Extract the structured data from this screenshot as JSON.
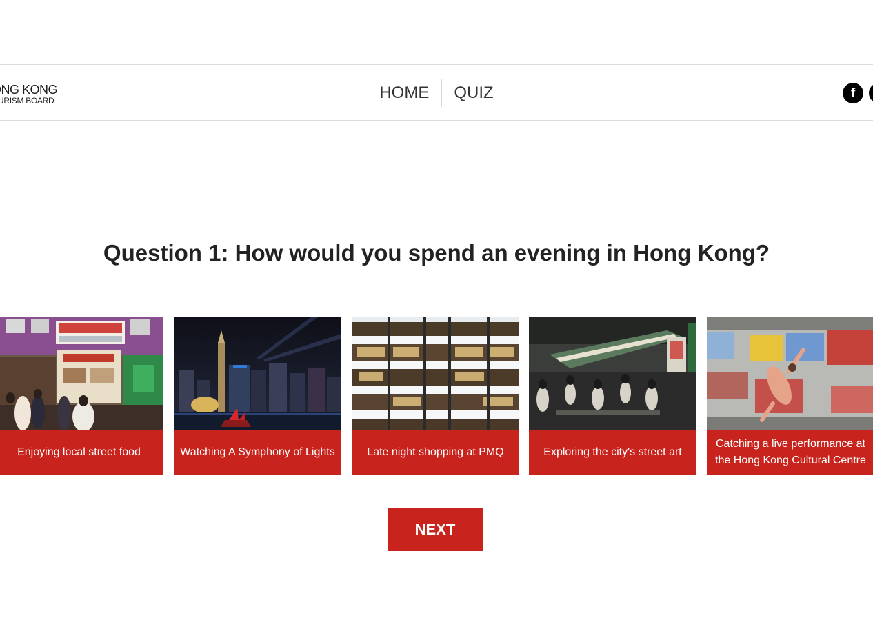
{
  "header": {
    "logo_line1": "ONG KONG",
    "logo_line2": "OURISM BOARD",
    "nav": [
      {
        "label": "HOME"
      },
      {
        "label": "QUIZ"
      }
    ],
    "social_icons": [
      "facebook-icon",
      "second-social-icon"
    ]
  },
  "quiz": {
    "question": "Question 1: How would you spend an evening in Hong Kong?",
    "options": [
      {
        "label": "Enjoying local street food"
      },
      {
        "label": "Watching A Symphony of Lights"
      },
      {
        "label": "Late night shopping at PMQ"
      },
      {
        "label": "Exploring the city's street art"
      },
      {
        "label": "Catching a live performance at the Hong Kong Cultural Centre"
      }
    ],
    "next_label": "NEXT"
  },
  "colors": {
    "accent": "#c8241d",
    "text": "#222222",
    "border": "#dcdcdc"
  }
}
